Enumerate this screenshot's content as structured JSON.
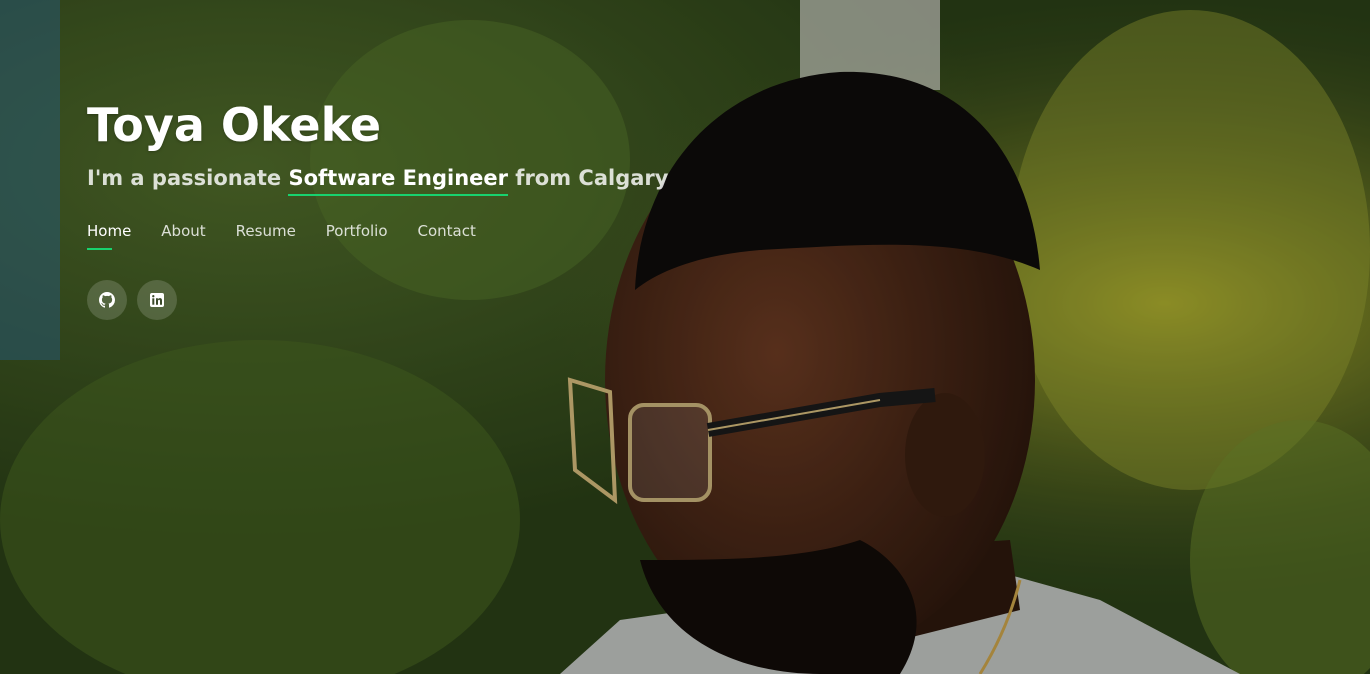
{
  "hero": {
    "name": "Toya Okeke",
    "subtitle_prefix": "I'm a passionate ",
    "subtitle_highlight": "Software Engineer",
    "subtitle_suffix": " from Calgary"
  },
  "nav": {
    "items": [
      {
        "label": "Home",
        "active": true
      },
      {
        "label": "About",
        "active": false
      },
      {
        "label": "Resume",
        "active": false
      },
      {
        "label": "Portfolio",
        "active": false
      },
      {
        "label": "Contact",
        "active": false
      }
    ]
  },
  "social": {
    "items": [
      {
        "icon": "github-icon"
      },
      {
        "icon": "linkedin-icon"
      }
    ]
  },
  "colors": {
    "accent": "#18d26e",
    "text": "#ffffff"
  }
}
